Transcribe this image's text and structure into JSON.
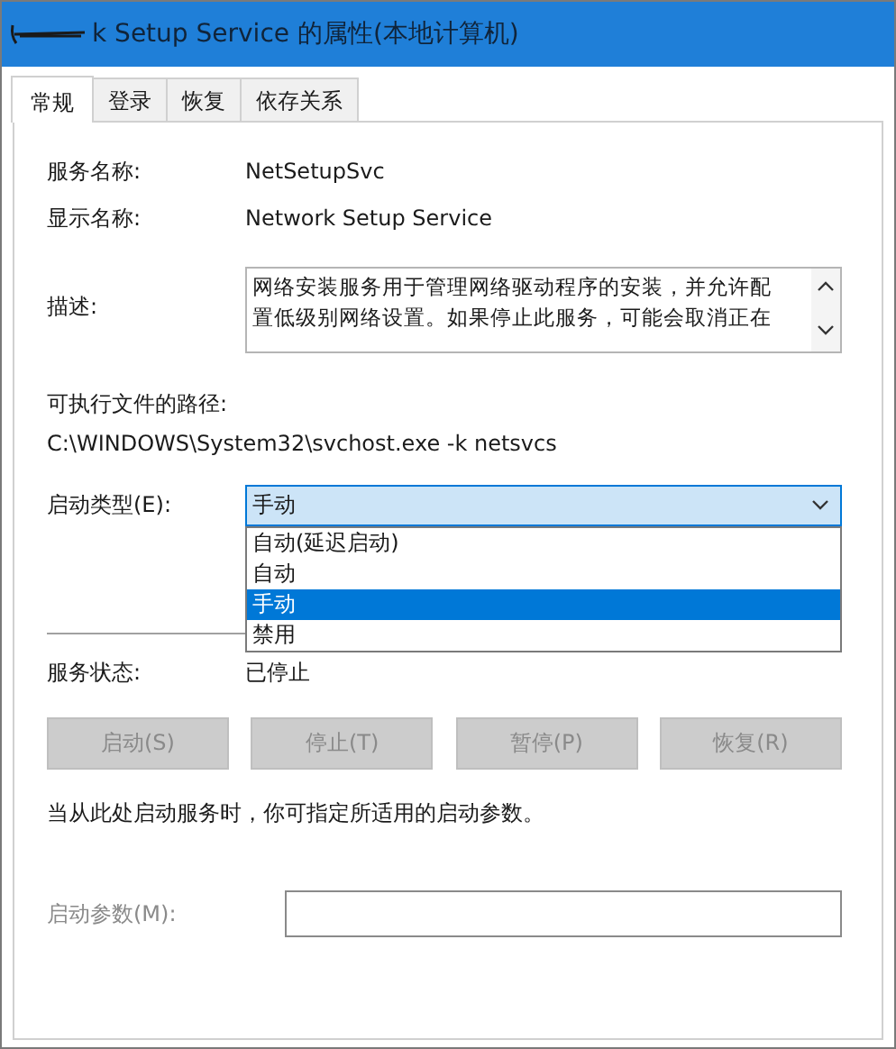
{
  "window": {
    "title": "k Setup Service 的属性(本地计算机)"
  },
  "tabs": [
    {
      "label": "常规",
      "selected": true
    },
    {
      "label": "登录",
      "selected": false
    },
    {
      "label": "恢复",
      "selected": false
    },
    {
      "label": "依存关系",
      "selected": false
    }
  ],
  "fields": [
    {
      "label": "服务名称:",
      "value": "NetSetupSvc"
    },
    {
      "label": "显示名称:",
      "value": "Network Setup Service"
    }
  ],
  "description": {
    "label": "描述:",
    "lines": [
      "网络安装服务用于管理网络驱动程序的安装，并允许配",
      "置低级别网络设置。如果停止此服务，可能会取消正在"
    ]
  },
  "path": {
    "label": "可执行文件的路径:",
    "value": "C:\\WINDOWS\\System32\\svchost.exe -k netsvcs"
  },
  "startup_type": {
    "label": "启动类型(E):",
    "value": "手动",
    "expanded": true,
    "options": [
      {
        "label": "自动(延迟启动)",
        "selected": false
      },
      {
        "label": "自动",
        "selected": false
      },
      {
        "label": "手动",
        "selected": true
      },
      {
        "label": "禁用",
        "selected": false
      }
    ]
  },
  "status": {
    "label": "服务状态:",
    "value": "已停止"
  },
  "buttons": [
    {
      "label": "启动(S)",
      "disabled": true
    },
    {
      "label": "停止(T)",
      "disabled": true
    },
    {
      "label": "暂停(P)",
      "disabled": true
    },
    {
      "label": "恢复(R)",
      "disabled": true
    }
  ],
  "hint": "当从此处启动服务时，你可指定所适用的启动参数。",
  "parameters": {
    "label": "启动参数(M):",
    "disabled": true
  }
}
